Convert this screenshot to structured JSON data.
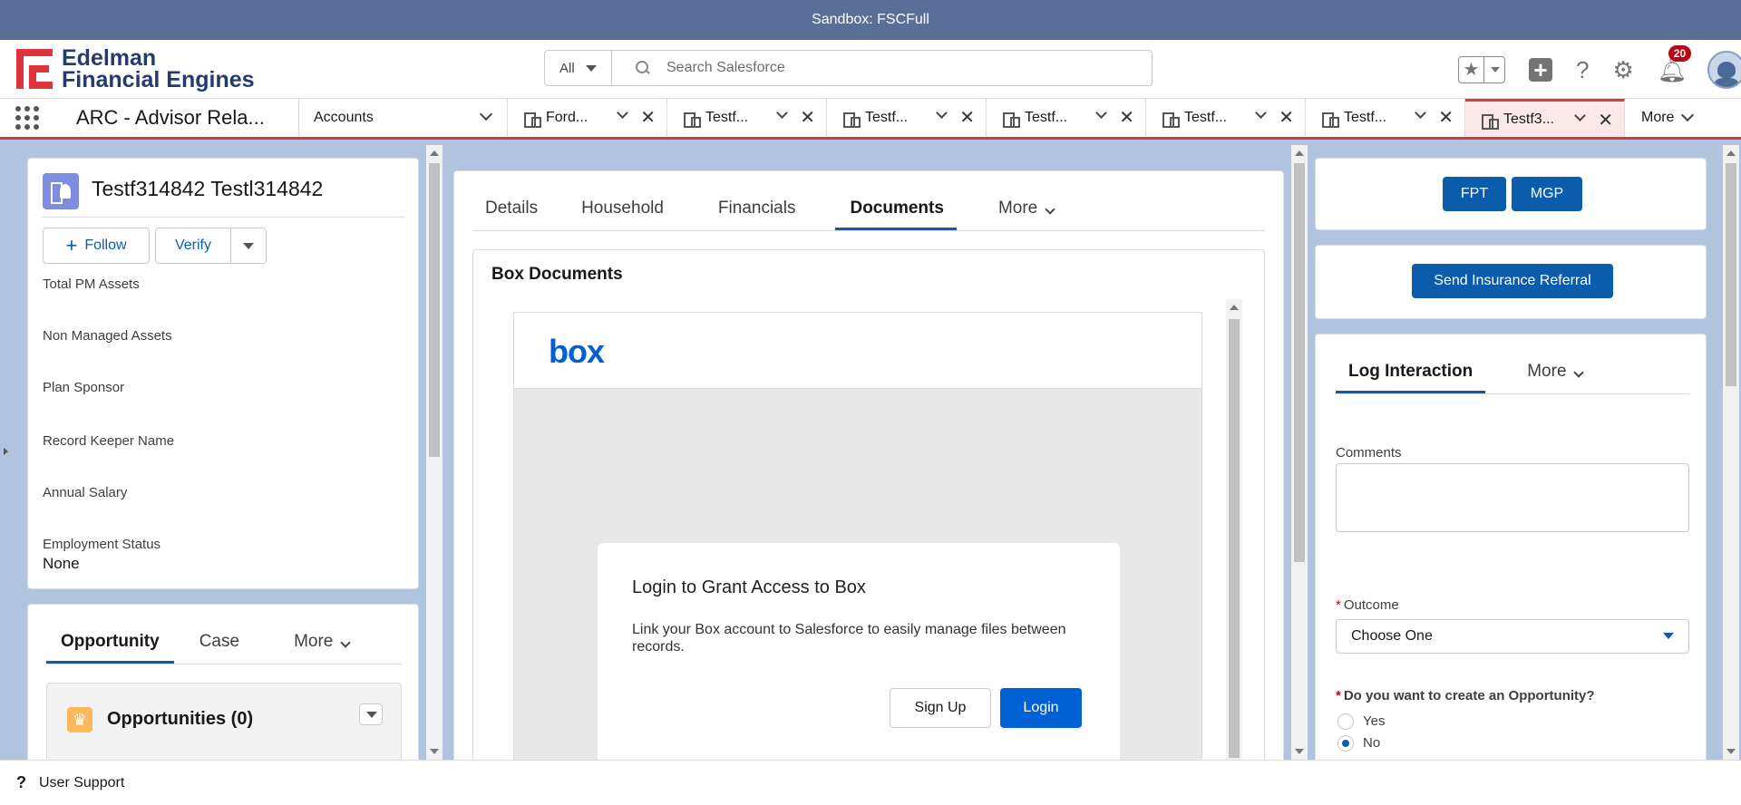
{
  "sandbox": {
    "label": "Sandbox: FSCFull"
  },
  "header": {
    "logo_line1": "Edelman",
    "logo_line2": "Financial Engines",
    "search_scope": "All",
    "search_placeholder": "Search Salesforce",
    "notification_count": "20"
  },
  "nav": {
    "app_name": "ARC - Advisor Rela...",
    "accounts_label": "Accounts",
    "tabs": [
      {
        "label": "Ford...",
        "icon": "building-icon"
      },
      {
        "label": "Testf...",
        "icon": "person-account-icon"
      },
      {
        "label": "Testf...",
        "icon": "person-account-icon"
      },
      {
        "label": "Testf...",
        "icon": "person-account-icon"
      },
      {
        "label": "Testf...",
        "icon": "building-icon"
      },
      {
        "label": "Testf...",
        "icon": "building-icon"
      },
      {
        "label": "Testf3...",
        "icon": "person-account-icon",
        "active": true
      }
    ],
    "more_label": "More"
  },
  "record": {
    "name": "Testf314842 Testl314842",
    "follow_label": "Follow",
    "verify_label": "Verify",
    "fields": [
      {
        "label": "Total PM Assets",
        "value": ""
      },
      {
        "label": "Non Managed Assets",
        "value": ""
      },
      {
        "label": "Plan Sponsor",
        "value": ""
      },
      {
        "label": "Record Keeper Name",
        "value": ""
      },
      {
        "label": "Annual Salary",
        "value": ""
      },
      {
        "label": "Employment Status",
        "value": "None"
      }
    ]
  },
  "related": {
    "tabs": [
      "Opportunity",
      "Case",
      "More"
    ],
    "opportunities_title": "Opportunities (0)"
  },
  "center": {
    "tabs": [
      "Details",
      "Household",
      "Financials",
      "Documents",
      "More"
    ],
    "selected_tab": "Documents",
    "card_title": "Box Documents",
    "box_logo": "box",
    "login_title": "Login to Grant Access to Box",
    "login_desc": "Link your Box account to Salesforce to easily manage files between records.",
    "signup_label": "Sign Up",
    "login_label": "Login"
  },
  "right": {
    "fpt_label": "FPT",
    "mgp_label": "MGP",
    "insurance_label": "Send Insurance Referral",
    "tabs": [
      "Log Interaction",
      "More"
    ],
    "comments_label": "Comments",
    "outcome_label": "Outcome",
    "outcome_value": "Choose One",
    "opportunity_question": "Do you want to create an Opportunity?",
    "opt_yes": "Yes",
    "opt_no": "No",
    "opportunity_selected": "No"
  },
  "utility": {
    "support_label": "User Support"
  },
  "colors": {
    "brand_blue": "#0b5cab",
    "sandbox_bar": "#5a6f97",
    "accent_red": "#d63a3f",
    "box_blue": "#0061d5"
  }
}
